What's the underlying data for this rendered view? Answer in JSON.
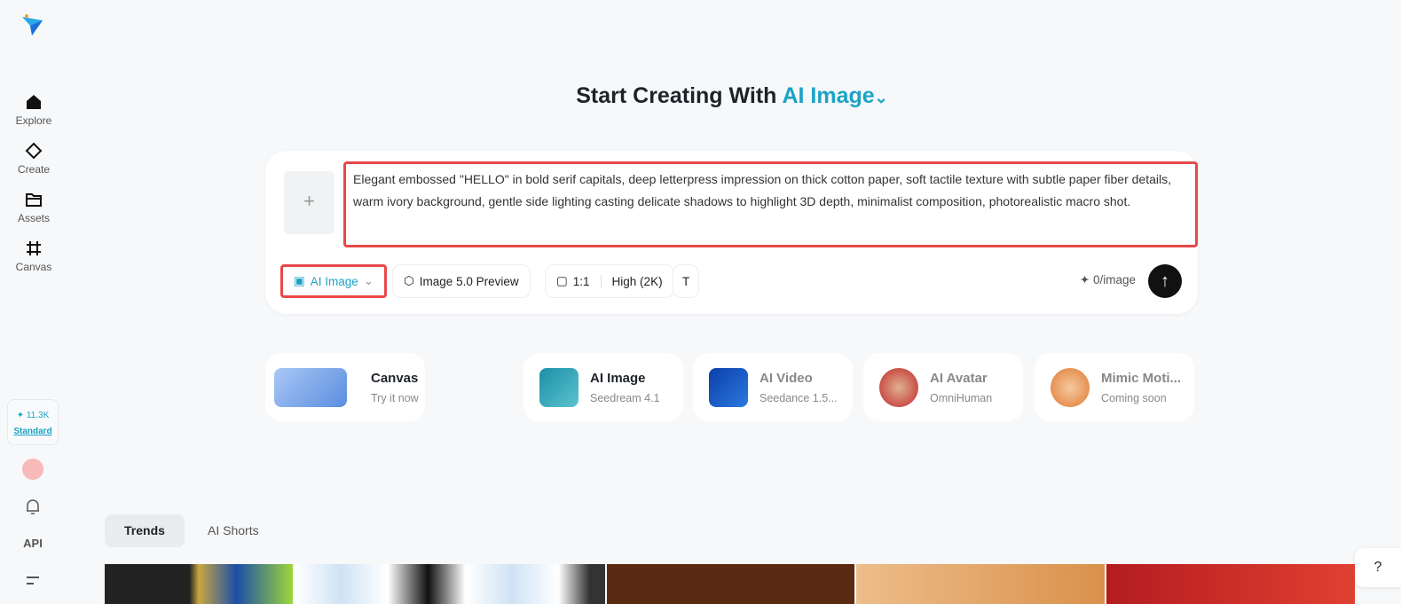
{
  "sidebar": {
    "items": [
      {
        "label": "Explore"
      },
      {
        "label": "Create"
      },
      {
        "label": "Assets"
      },
      {
        "label": "Canvas"
      }
    ],
    "credits": "✦ 11.3K",
    "plan": "Standard",
    "api": "API"
  },
  "header": {
    "prefix": "Start Creating With",
    "mode": "AI Image",
    "chevron": "⌄"
  },
  "composer": {
    "add": "+",
    "prompt": "Elegant embossed \"HELLO\" in bold serif capitals, deep letterpress impression on thick cotton paper, soft tactile texture with subtle paper fiber details, warm ivory background, gentle side lighting casting delicate shadows to highlight 3D depth, minimalist composition, photorealistic macro shot.",
    "mode": "AI Image",
    "model": "Image 5.0 Preview",
    "ratio": "1:1",
    "quality": "High (2K)",
    "cost": "✦ 0/image",
    "send": "↑"
  },
  "features": [
    {
      "name": "Canvas",
      "sub": "Try it now"
    },
    {
      "name": "AI Image",
      "sub": "Seedream 4.1"
    },
    {
      "name": "AI Video",
      "sub": "Seedance 1.5..."
    },
    {
      "name": "AI Avatar",
      "sub": "OmniHuman"
    },
    {
      "name": "Mimic Moti...",
      "sub": "Coming soon"
    }
  ],
  "tabs": [
    {
      "label": "Trends"
    },
    {
      "label": "AI Shorts"
    }
  ],
  "help": "?",
  "colors": {
    "accent": "#1ba3c6",
    "highlight": "#e84848"
  }
}
